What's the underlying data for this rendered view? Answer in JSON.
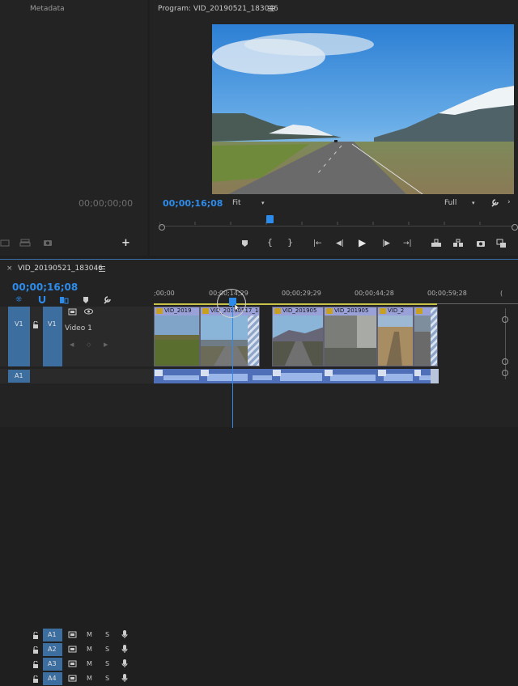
{
  "source_panel": {
    "tab_metadata": "Metadata",
    "timecode": "00;00;00;00"
  },
  "program_monitor": {
    "title": "Program: VID_20190521_183046",
    "menu_icon": "hamburger-icon",
    "current_timecode": "00;00;16;08",
    "fit_label": "Fit",
    "resolution_label": "Full",
    "playhead_fraction": 0.31
  },
  "timeline": {
    "close_label": "×",
    "sequence_name": "VID_20190521_183046",
    "current_timecode": "00;00;16;08",
    "ruler_labels": [
      ";00;00",
      "00;00;14;29",
      "00;00;29;29",
      "00;00;44;28",
      "00;00;59;28"
    ],
    "tracks": {
      "v1_source": "V1",
      "v1_target": "V1",
      "video1_name": "Video 1",
      "a1_source": "A1",
      "audio": [
        "A1",
        "A2",
        "A3",
        "A4"
      ],
      "mute": "M",
      "solo": "S"
    },
    "video_clips": [
      {
        "label": "VID_2019"
      },
      {
        "label": "VID_20190517_143"
      },
      {
        "label": "VID_201905"
      },
      {
        "label": "VID_201905"
      },
      {
        "label": "VID_2"
      },
      {
        "label": ""
      }
    ]
  },
  "colors": {
    "accent": "#2d8ceb",
    "track_target": "#3d6ea0",
    "clip_label": "#9aa0d8",
    "audio_clip": "#5a78c8"
  }
}
